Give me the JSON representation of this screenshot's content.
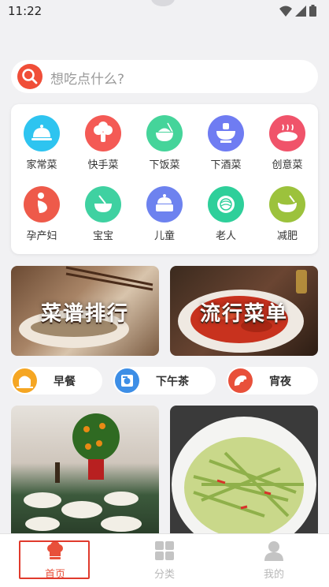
{
  "status_bar": {
    "time": "11:22"
  },
  "search": {
    "placeholder": "想吃点什么?"
  },
  "categories": [
    {
      "label": "家常菜",
      "color": "#2ec4f0",
      "icon": "cloche-icon"
    },
    {
      "label": "快手菜",
      "color": "#f45a55",
      "icon": "broccoli-icon"
    },
    {
      "label": "下饭菜",
      "color": "#45d49a",
      "icon": "rice-bowl-icon"
    },
    {
      "label": "下酒菜",
      "color": "#6f7cf2",
      "icon": "hotpot-icon"
    },
    {
      "label": "创意菜",
      "color": "#f0536a",
      "icon": "plate-icon"
    },
    {
      "label": "孕产妇",
      "color": "#ee5a4a",
      "icon": "pregnant-icon"
    },
    {
      "label": "宝宝",
      "color": "#3fd1a1",
      "icon": "baby-bowl-icon"
    },
    {
      "label": "儿童",
      "color": "#6d82ef",
      "icon": "cake-icon"
    },
    {
      "label": "老人",
      "color": "#2ecf9a",
      "icon": "noodle-bowl-icon"
    },
    {
      "label": "减肥",
      "color": "#9cc23c",
      "icon": "soup-bowl-icon"
    }
  ],
  "banners": [
    {
      "title": "菜谱排行"
    },
    {
      "title": "流行菜单"
    }
  ],
  "meal_tabs": [
    {
      "label": "早餐",
      "color": "#f5a623",
      "icon": "breakfast-icon"
    },
    {
      "label": "下午茶",
      "color": "#3d8ee6",
      "icon": "tea-icon"
    },
    {
      "label": "宵夜",
      "color": "#e8503a",
      "icon": "night-snack-icon"
    }
  ],
  "bottom_nav": [
    {
      "label": "首页",
      "active": true,
      "icon": "chef-hat-icon"
    },
    {
      "label": "分类",
      "active": false,
      "icon": "grid-icon"
    },
    {
      "label": "我的",
      "active": false,
      "icon": "user-icon"
    }
  ],
  "colors": {
    "accent": "#f04e38",
    "active_tab": "#e03a2c",
    "inactive_tab": "#b8b8b8"
  }
}
